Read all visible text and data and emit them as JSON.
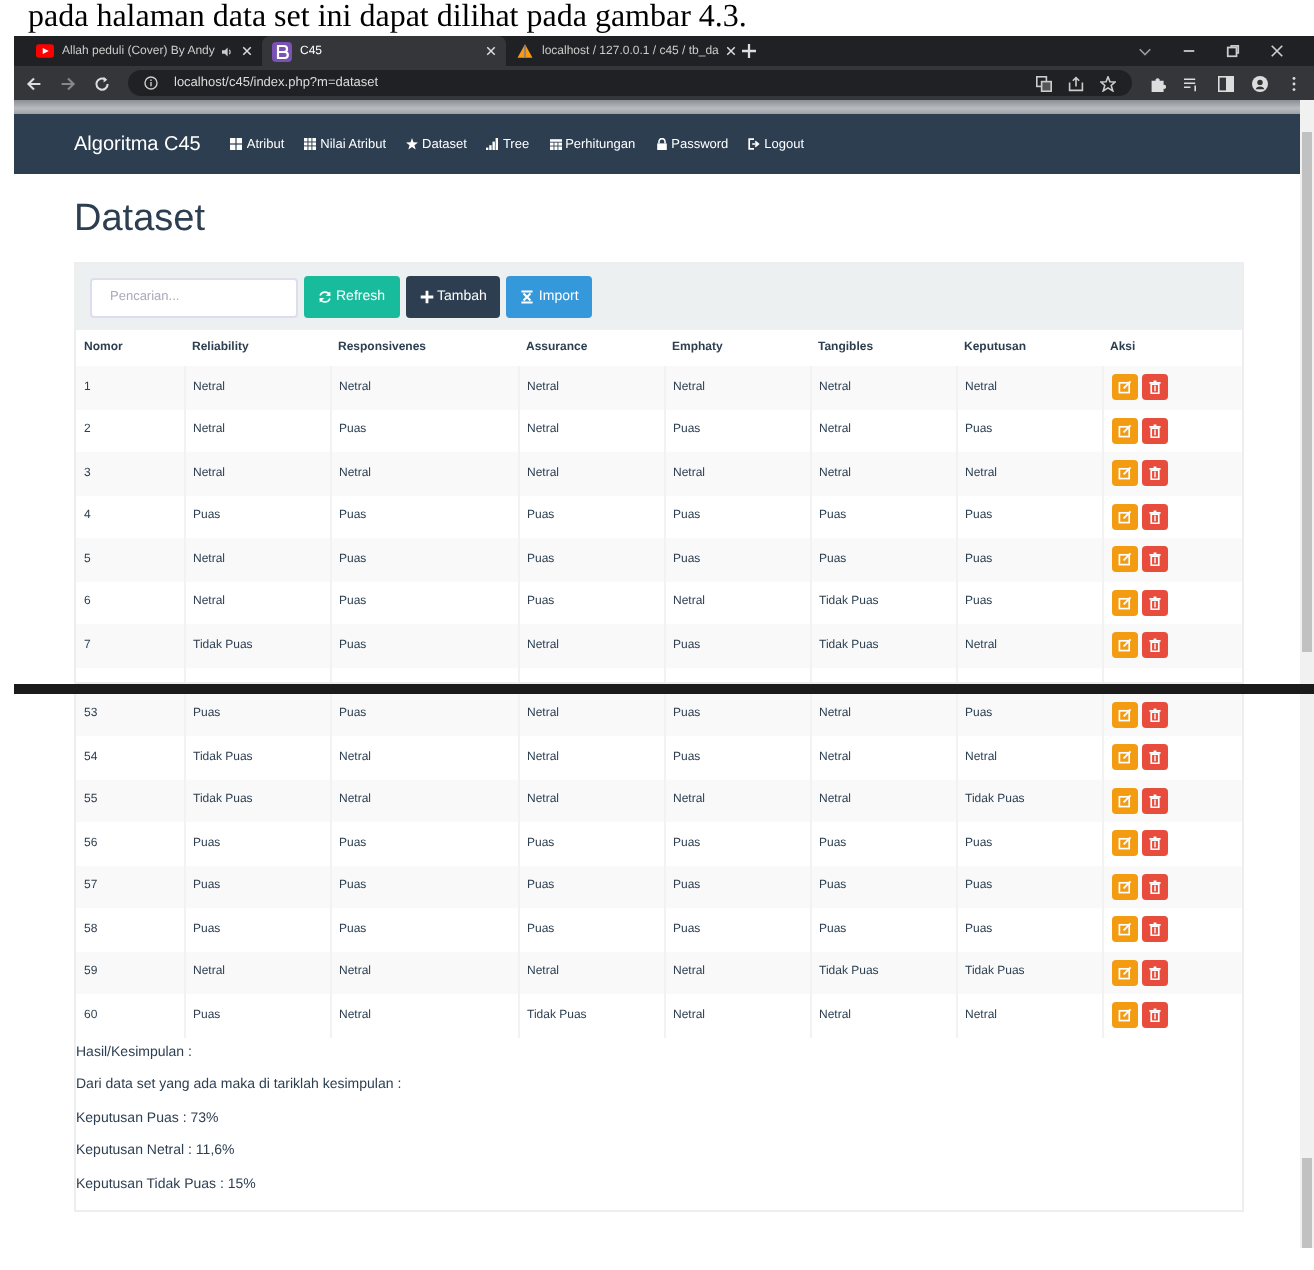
{
  "caption": "pada halaman data set ini dapat dilihat pada gambar 4.3.",
  "browser": {
    "tabs": [
      {
        "title": "Allah peduli (Cover) By Andy",
        "audio": true,
        "selected": false
      },
      {
        "title": "C45",
        "audio": false,
        "selected": true
      },
      {
        "title": "localhost / 127.0.0.1 / c45 / tb_da",
        "audio": false,
        "selected": false
      }
    ],
    "url": "localhost/c45/index.php?m=dataset"
  },
  "navbar": {
    "brand": "Algoritma C45",
    "items": [
      {
        "label": "Atribut"
      },
      {
        "label": "Nilai Atribut"
      },
      {
        "label": "Dataset"
      },
      {
        "label": "Tree"
      },
      {
        "label": "Perhitungan"
      },
      {
        "label": "Password"
      },
      {
        "label": "Logout"
      }
    ]
  },
  "heading": "Dataset",
  "search": {
    "placeholder": "Pencarian..."
  },
  "buttons": [
    {
      "label": "Refresh",
      "kind": "refresh"
    },
    {
      "label": "Tambah",
      "kind": "add"
    },
    {
      "label": "Import",
      "kind": "import"
    }
  ],
  "table": {
    "columns": [
      "Nomor",
      "Reliability",
      "Responsivenes",
      "Assurance",
      "Emphaty",
      "Tangibles",
      "Keputusan",
      "Aksi"
    ],
    "rows": [
      [
        "1",
        "Netral",
        "Netral",
        "Netral",
        "Netral",
        "Netral",
        "Netral"
      ],
      [
        "2",
        "Netral",
        "Puas",
        "Netral",
        "Puas",
        "Netral",
        "Puas"
      ],
      [
        "3",
        "Netral",
        "Netral",
        "Netral",
        "Netral",
        "Netral",
        "Netral"
      ],
      [
        "4",
        "Puas",
        "Puas",
        "Puas",
        "Puas",
        "Puas",
        "Puas"
      ],
      [
        "5",
        "Netral",
        "Puas",
        "Puas",
        "Puas",
        "Puas",
        "Puas"
      ],
      [
        "6",
        "Netral",
        "Puas",
        "Puas",
        "Netral",
        "Tidak Puas",
        "Puas"
      ],
      [
        "7",
        "Tidak Puas",
        "Puas",
        "Netral",
        "Puas",
        "Tidak Puas",
        "Netral"
      ]
    ]
  },
  "table_continued": {
    "rows": [
      [
        "53",
        "Puas",
        "Puas",
        "Netral",
        "Puas",
        "Netral",
        "Puas"
      ],
      [
        "54",
        "Tidak Puas",
        "Netral",
        "Netral",
        "Puas",
        "Netral",
        "Netral"
      ],
      [
        "55",
        "Tidak Puas",
        "Netral",
        "Netral",
        "Netral",
        "Netral",
        "Tidak Puas"
      ],
      [
        "56",
        "Puas",
        "Puas",
        "Puas",
        "Puas",
        "Puas",
        "Puas"
      ],
      [
        "57",
        "Puas",
        "Puas",
        "Puas",
        "Puas",
        "Puas",
        "Puas"
      ],
      [
        "58",
        "Puas",
        "Puas",
        "Puas",
        "Puas",
        "Puas",
        "Puas"
      ],
      [
        "59",
        "Netral",
        "Netral",
        "Netral",
        "Netral",
        "Tidak Puas",
        "Tidak Puas"
      ],
      [
        "60",
        "Puas",
        "Netral",
        "Tidak Puas",
        "Netral",
        "Netral",
        "Netral"
      ]
    ]
  },
  "conclusion": [
    "Hasil/Kesimpulan :",
    "Dari data set yang ada maka di tariklah kesimpulan :",
    "Keputusan Puas : 73%",
    "Keputusan Netral : 11,6%",
    "Keputusan Tidak Puas : 15%"
  ]
}
